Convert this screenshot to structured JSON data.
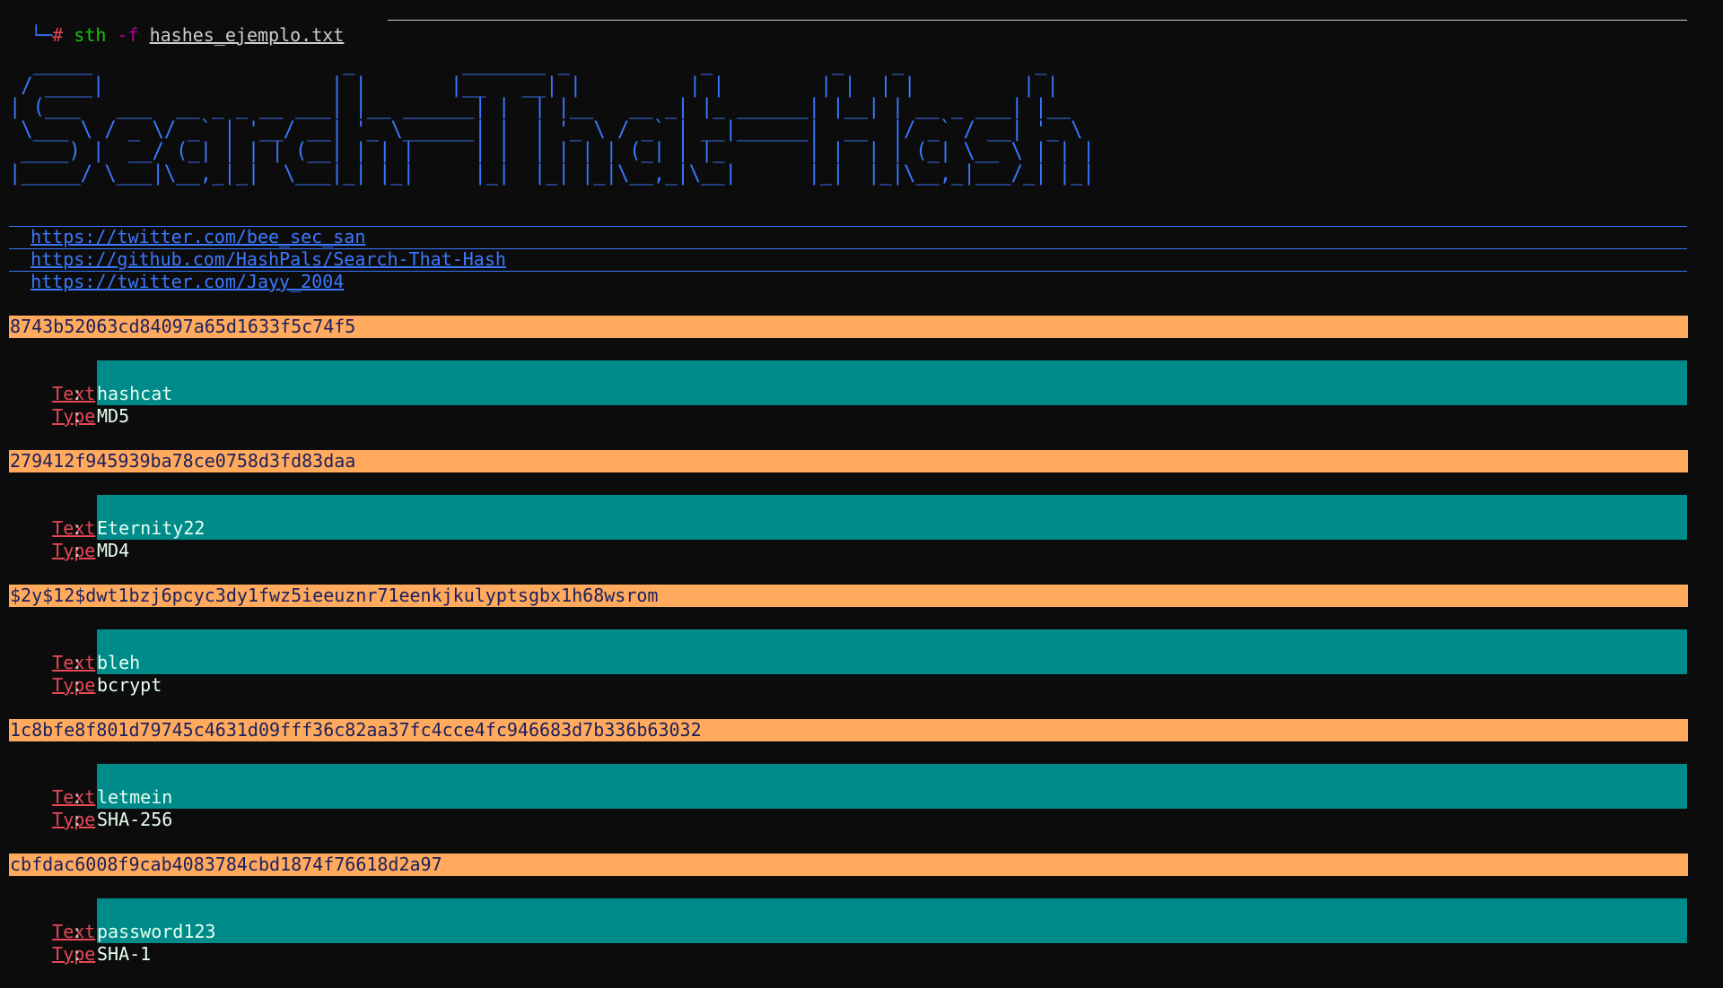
{
  "prompt": {
    "corner": "└─",
    "hash": "#",
    "command": "sth",
    "flag": "-f",
    "file": "hashes_ejemplo.txt"
  },
  "banner": {
    "art": "  _____                     _         _______ _           _          _    _           _     \n / ____|                   | |       |__   __| |         | |        | |  | |         | |    \n| (___   ___  __ _ _ __ ___| |__ ______| |  | |__   __ _| |_ ______| |__| | __ _ ___| |__  \n \\___ \\ / _ \\/ _` | '__/ __| '_ \\______| |  | '_ \\ / _` | __|______|  __  |/ _` / __| '_ \\ \n ____) |  __/ (_| | | | (__| | | |     | |  | | | | (_| | |_       | |  | | (_| \\__ \\ | | |\n|_____/ \\___|\\__,_|_|  \\___|_| |_|     |_|  |_| |_|\\__,_|\\__|      |_|  |_|\\__,_|___/_| |_|"
  },
  "links": [
    "https://twitter.com/bee_sec_san",
    "https://github.com/HashPals/Search-That-Hash",
    "https://twitter.com/Jayy_2004"
  ],
  "labels": {
    "text_key": "Text",
    "type_key": "Type",
    "separator": ":"
  },
  "results": [
    {
      "hash": "8743b52063cd84097a65d1633f5c74f5",
      "text": "hashcat",
      "type": "MD5"
    },
    {
      "hash": "279412f945939ba78ce0758d3fd83daa",
      "text": "Eternity22",
      "type": "MD4"
    },
    {
      "hash": "$2y$12$dwt1bzj6pcyc3dy1fwz5ieeuznr71eenkjkulyptsgbx1h68wsrom",
      "text": "bleh",
      "type": "bcrypt"
    },
    {
      "hash": "1c8bfe8f801d79745c4631d09fff36c82aa37fc4cce4fc946683d7b336b63032",
      "text": "letmein",
      "type": "SHA-256"
    },
    {
      "hash": "cbfdac6008f9cab4083784cbd1874f76618d2a97",
      "text": "password123",
      "type": "SHA-1"
    }
  ],
  "colors": {
    "background": "#0c0c0c",
    "banner_blue": "#3b78ff",
    "hash_bar": "#ffaa5c",
    "result_bar": "#008b8b",
    "key_red": "#e74856",
    "prompt_green": "#16c60c",
    "prompt_magenta": "#b4009e"
  }
}
